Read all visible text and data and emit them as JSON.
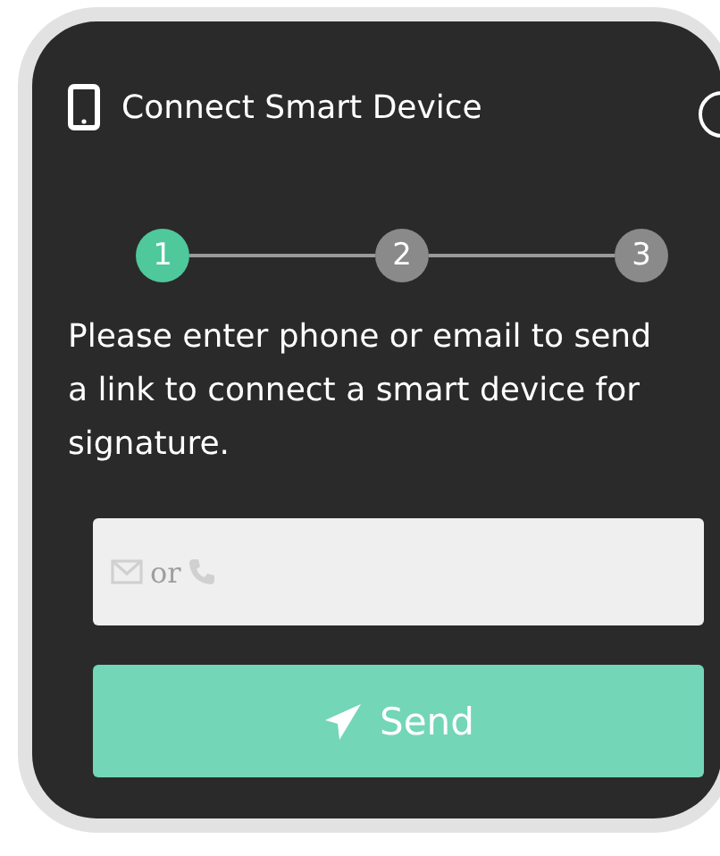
{
  "header": {
    "title": "Connect Smart Device"
  },
  "steps": [
    {
      "label": "1",
      "selected": true
    },
    {
      "label": "2",
      "selected": false
    },
    {
      "label": "3",
      "selected": false
    }
  ],
  "instructions": "Please enter phone or email to send a link to connect a smart device for signature.",
  "contact_field": {
    "hint": "or"
  },
  "send_button": {
    "label": "Send"
  }
}
